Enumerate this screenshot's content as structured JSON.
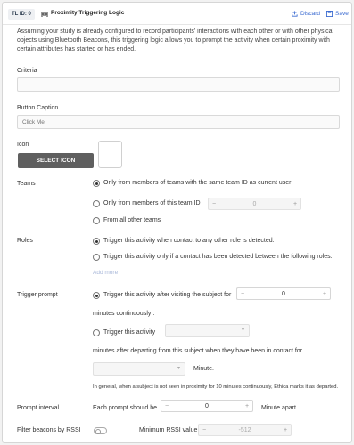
{
  "header": {
    "badge": "TL ID: 0",
    "title": "Proximity Triggering Logic",
    "discard_label": "Discard",
    "save_label": "Save",
    "accent_color": "#3b6bd1"
  },
  "description": "Assuming your study is already configured to record participants' interactions with each other or with other physical objects using Bluetooth Beacons, this triggering logic allows you to prompt the activity when certain proximity with certain attributes has started or has ended.",
  "criteria": {
    "label": "Criteria",
    "value": ""
  },
  "button_caption": {
    "label": "Button Caption",
    "placeholder": "Click Me"
  },
  "icon": {
    "label": "Icon",
    "button_label": "SELECT ICON"
  },
  "teams": {
    "label": "Teams",
    "options": [
      "Only from members of teams with the same team ID as current user",
      "Only from members of this team ID",
      "From all other teams"
    ],
    "selected_index": 0,
    "team_id_value": "0"
  },
  "roles": {
    "label": "Roles",
    "options": [
      "Trigger this activity when contact to any other role is detected.",
      "Trigger this activity only if a contact has been detected between the following roles:"
    ],
    "selected_index": 0,
    "add_more": "Add more"
  },
  "trigger_prompt": {
    "label": "Trigger prompt",
    "option_after_visiting": "Trigger this activity after visiting the subject for",
    "visiting_minutes": "0",
    "minutes_continuously": "minutes continuously .",
    "option_trigger": "Trigger this activity",
    "minutes_after_departing": "minutes after departing from this subject when they have been in contact for",
    "minute_suffix": "Minute.",
    "note": "In general, when a subject is not seen in proximity for 10 minutes continuously, Ethica marks it as departed.",
    "selected_index": 0
  },
  "prompt_interval": {
    "label": "Prompt interval",
    "prefix": "Each prompt should be",
    "value": "0",
    "suffix": "Minute apart."
  },
  "filter_beacons": {
    "label": "Filter beacons by RSSI",
    "enabled": false,
    "min_rssi_label": "Minimum RSSI value:",
    "min_rssi_value": "-512"
  },
  "stepper_symbols": {
    "minus": "−",
    "plus": "+"
  }
}
